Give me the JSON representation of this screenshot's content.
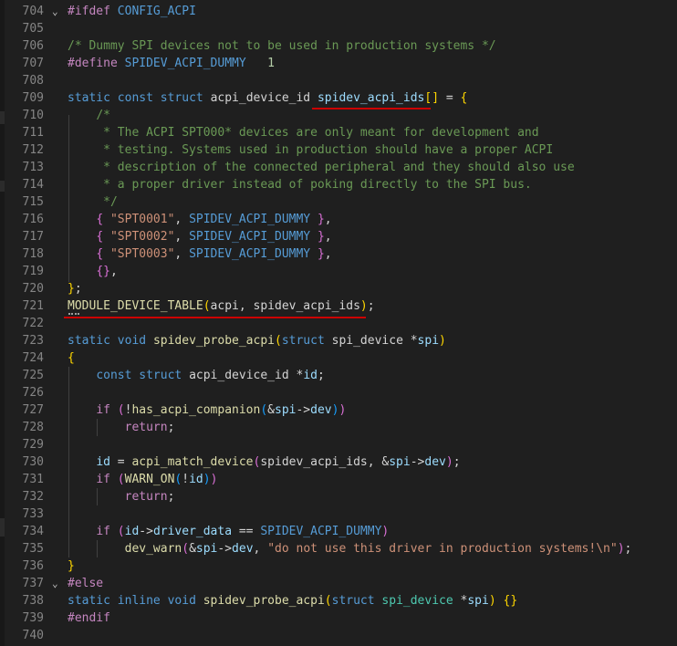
{
  "editor": {
    "lines": [
      {
        "n": "704",
        "fold": "⌄",
        "tokens": [
          [
            "k2",
            "#ifdef"
          ],
          [
            "pl",
            " "
          ],
          [
            "m",
            "CONFIG_ACPI"
          ]
        ]
      },
      {
        "n": "705",
        "fold": "",
        "tokens": []
      },
      {
        "n": "706",
        "fold": "",
        "tokens": [
          [
            "c",
            "/* Dummy SPI devices not to be used in production systems */"
          ]
        ]
      },
      {
        "n": "707",
        "fold": "",
        "tokens": [
          [
            "k2",
            "#define"
          ],
          [
            "pl",
            " "
          ],
          [
            "m",
            "SPIDEV_ACPI_DUMMY"
          ],
          [
            "pl",
            "   "
          ],
          [
            "n",
            "1"
          ]
        ]
      },
      {
        "n": "708",
        "fold": "",
        "tokens": []
      },
      {
        "n": "709",
        "fold": "",
        "tokens": [
          [
            "k",
            "static"
          ],
          [
            "pl",
            " "
          ],
          [
            "k",
            "const"
          ],
          [
            "pl",
            " "
          ],
          [
            "k",
            "struct"
          ],
          [
            "pl",
            " "
          ],
          [
            "pl",
            "acpi_device_id "
          ],
          [
            "v",
            "spidev_acpi_ids"
          ],
          [
            "p1",
            "[]"
          ],
          [
            "pl",
            " = "
          ],
          [
            "p1",
            "{"
          ]
        ]
      },
      {
        "n": "710",
        "fold": "",
        "tokens": [
          [
            "pl",
            "    "
          ],
          [
            "c",
            "/*"
          ]
        ]
      },
      {
        "n": "711",
        "fold": "",
        "tokens": [
          [
            "c",
            "     * The ACPI SPT000* devices are only meant for development and"
          ]
        ]
      },
      {
        "n": "712",
        "fold": "",
        "tokens": [
          [
            "c",
            "     * testing. Systems used in production should have a proper ACPI"
          ]
        ]
      },
      {
        "n": "713",
        "fold": "",
        "tokens": [
          [
            "c",
            "     * description of the connected peripheral and they should also use"
          ]
        ]
      },
      {
        "n": "714",
        "fold": "",
        "tokens": [
          [
            "c",
            "     * a proper driver instead of poking directly to the SPI bus."
          ]
        ]
      },
      {
        "n": "715",
        "fold": "",
        "tokens": [
          [
            "c",
            "     */"
          ]
        ]
      },
      {
        "n": "716",
        "fold": "",
        "tokens": [
          [
            "pl",
            "    "
          ],
          [
            "p2",
            "{"
          ],
          [
            "pl",
            " "
          ],
          [
            "s",
            "\"SPT0001\""
          ],
          [
            "pl",
            ", "
          ],
          [
            "m",
            "SPIDEV_ACPI_DUMMY"
          ],
          [
            "pl",
            " "
          ],
          [
            "p2",
            "}"
          ],
          [
            "pl",
            ","
          ]
        ]
      },
      {
        "n": "717",
        "fold": "",
        "tokens": [
          [
            "pl",
            "    "
          ],
          [
            "p2",
            "{"
          ],
          [
            "pl",
            " "
          ],
          [
            "s",
            "\"SPT0002\""
          ],
          [
            "pl",
            ", "
          ],
          [
            "m",
            "SPIDEV_ACPI_DUMMY"
          ],
          [
            "pl",
            " "
          ],
          [
            "p2",
            "}"
          ],
          [
            "pl",
            ","
          ]
        ]
      },
      {
        "n": "718",
        "fold": "",
        "tokens": [
          [
            "pl",
            "    "
          ],
          [
            "p2",
            "{"
          ],
          [
            "pl",
            " "
          ],
          [
            "s",
            "\"SPT0003\""
          ],
          [
            "pl",
            ", "
          ],
          [
            "m",
            "SPIDEV_ACPI_DUMMY"
          ],
          [
            "pl",
            " "
          ],
          [
            "p2",
            "}"
          ],
          [
            "pl",
            ","
          ]
        ]
      },
      {
        "n": "719",
        "fold": "",
        "tokens": [
          [
            "pl",
            "    "
          ],
          [
            "p2",
            "{}"
          ],
          [
            "pl",
            ","
          ]
        ]
      },
      {
        "n": "720",
        "fold": "",
        "tokens": [
          [
            "p1",
            "}"
          ],
          [
            "pl",
            ";"
          ]
        ]
      },
      {
        "n": "721",
        "fold": "",
        "tokens": [
          [
            "f",
            "MODULE_DEVICE_TABLE"
          ],
          [
            "p1",
            "("
          ],
          [
            "pl",
            "acpi, spidev_acpi_ids"
          ],
          [
            "p1",
            ")"
          ],
          [
            "pl",
            ";"
          ]
        ]
      },
      {
        "n": "722",
        "fold": "",
        "tokens": []
      },
      {
        "n": "723",
        "fold": "",
        "tokens": [
          [
            "k",
            "static"
          ],
          [
            "pl",
            " "
          ],
          [
            "k",
            "void"
          ],
          [
            "pl",
            " "
          ],
          [
            "f",
            "spidev_probe_acpi"
          ],
          [
            "p1",
            "("
          ],
          [
            "k",
            "struct"
          ],
          [
            "pl",
            " spi_device *"
          ],
          [
            "v",
            "spi"
          ],
          [
            "p1",
            ")"
          ]
        ]
      },
      {
        "n": "724",
        "fold": "",
        "tokens": [
          [
            "p1",
            "{"
          ]
        ]
      },
      {
        "n": "725",
        "fold": "",
        "tokens": [
          [
            "pl",
            "    "
          ],
          [
            "k",
            "const"
          ],
          [
            "pl",
            " "
          ],
          [
            "k",
            "struct"
          ],
          [
            "pl",
            " acpi_device_id *"
          ],
          [
            "v",
            "id"
          ],
          [
            "pl",
            ";"
          ]
        ]
      },
      {
        "n": "726",
        "fold": "",
        "tokens": []
      },
      {
        "n": "727",
        "fold": "",
        "tokens": [
          [
            "pl",
            "    "
          ],
          [
            "k2",
            "if"
          ],
          [
            "pl",
            " "
          ],
          [
            "p2",
            "("
          ],
          [
            "pl",
            "!"
          ],
          [
            "f",
            "has_acpi_companion"
          ],
          [
            "p3",
            "("
          ],
          [
            "pl",
            "&"
          ],
          [
            "v",
            "spi"
          ],
          [
            "pl",
            "->"
          ],
          [
            "v",
            "dev"
          ],
          [
            "p3",
            ")"
          ],
          [
            "p2",
            ")"
          ]
        ]
      },
      {
        "n": "728",
        "fold": "",
        "tokens": [
          [
            "pl",
            "        "
          ],
          [
            "k2",
            "return"
          ],
          [
            "pl",
            ";"
          ]
        ]
      },
      {
        "n": "729",
        "fold": "",
        "tokens": []
      },
      {
        "n": "730",
        "fold": "",
        "tokens": [
          [
            "pl",
            "    "
          ],
          [
            "v",
            "id"
          ],
          [
            "pl",
            " = "
          ],
          [
            "f",
            "acpi_match_device"
          ],
          [
            "p2",
            "("
          ],
          [
            "pl",
            "spidev_acpi_ids, &"
          ],
          [
            "v",
            "spi"
          ],
          [
            "pl",
            "->"
          ],
          [
            "v",
            "dev"
          ],
          [
            "p2",
            ")"
          ],
          [
            "pl",
            ";"
          ]
        ]
      },
      {
        "n": "731",
        "fold": "",
        "tokens": [
          [
            "pl",
            "    "
          ],
          [
            "k2",
            "if"
          ],
          [
            "pl",
            " "
          ],
          [
            "p2",
            "("
          ],
          [
            "f",
            "WARN_ON"
          ],
          [
            "p3",
            "("
          ],
          [
            "pl",
            "!"
          ],
          [
            "v",
            "id"
          ],
          [
            "p3",
            ")"
          ],
          [
            "p2",
            ")"
          ]
        ]
      },
      {
        "n": "732",
        "fold": "",
        "tokens": [
          [
            "pl",
            "        "
          ],
          [
            "k2",
            "return"
          ],
          [
            "pl",
            ";"
          ]
        ]
      },
      {
        "n": "733",
        "fold": "",
        "tokens": []
      },
      {
        "n": "734",
        "fold": "",
        "tokens": [
          [
            "pl",
            "    "
          ],
          [
            "k2",
            "if"
          ],
          [
            "pl",
            " "
          ],
          [
            "p2",
            "("
          ],
          [
            "v",
            "id"
          ],
          [
            "pl",
            "->"
          ],
          [
            "v",
            "driver_data"
          ],
          [
            "pl",
            " == "
          ],
          [
            "m",
            "SPIDEV_ACPI_DUMMY"
          ],
          [
            "p2",
            ")"
          ]
        ]
      },
      {
        "n": "735",
        "fold": "",
        "tokens": [
          [
            "pl",
            "        "
          ],
          [
            "f",
            "dev_warn"
          ],
          [
            "p2",
            "("
          ],
          [
            "pl",
            "&"
          ],
          [
            "v",
            "spi"
          ],
          [
            "pl",
            "->"
          ],
          [
            "v",
            "dev"
          ],
          [
            "pl",
            ", "
          ],
          [
            "s",
            "\"do not use this driver in production systems!\\n\""
          ],
          [
            "p2",
            ")"
          ],
          [
            "pl",
            ";"
          ]
        ]
      },
      {
        "n": "736",
        "fold": "",
        "tokens": [
          [
            "p1",
            "}"
          ]
        ]
      },
      {
        "n": "737",
        "fold": "⌄",
        "tokens": [
          [
            "k2",
            "#else"
          ]
        ]
      },
      {
        "n": "738",
        "fold": "",
        "tokens": [
          [
            "k",
            "static"
          ],
          [
            "pl",
            " "
          ],
          [
            "k",
            "inline"
          ],
          [
            "pl",
            " "
          ],
          [
            "k",
            "void"
          ],
          [
            "pl",
            " "
          ],
          [
            "f",
            "spidev_probe_acpi"
          ],
          [
            "p1",
            "("
          ],
          [
            "k",
            "struct"
          ],
          [
            "pl",
            " "
          ],
          [
            "t",
            "spi_device"
          ],
          [
            "pl",
            " *"
          ],
          [
            "v",
            "spi"
          ],
          [
            "p1",
            ")"
          ],
          [
            "pl",
            " "
          ],
          [
            "p1",
            "{}"
          ]
        ]
      },
      {
        "n": "739",
        "fold": "",
        "tokens": [
          [
            "k2",
            "#endif"
          ]
        ]
      },
      {
        "n": "740",
        "fold": "",
        "tokens": []
      }
    ]
  },
  "colors": {
    "background": "#1f1f1f",
    "line_number": "#858585",
    "keyword": "#569cd6",
    "control": "#c586c0",
    "function": "#dcdcaa",
    "variable": "#9cdcfe",
    "string": "#ce9178",
    "comment": "#6a9955",
    "squiggle": "#cc0000"
  }
}
